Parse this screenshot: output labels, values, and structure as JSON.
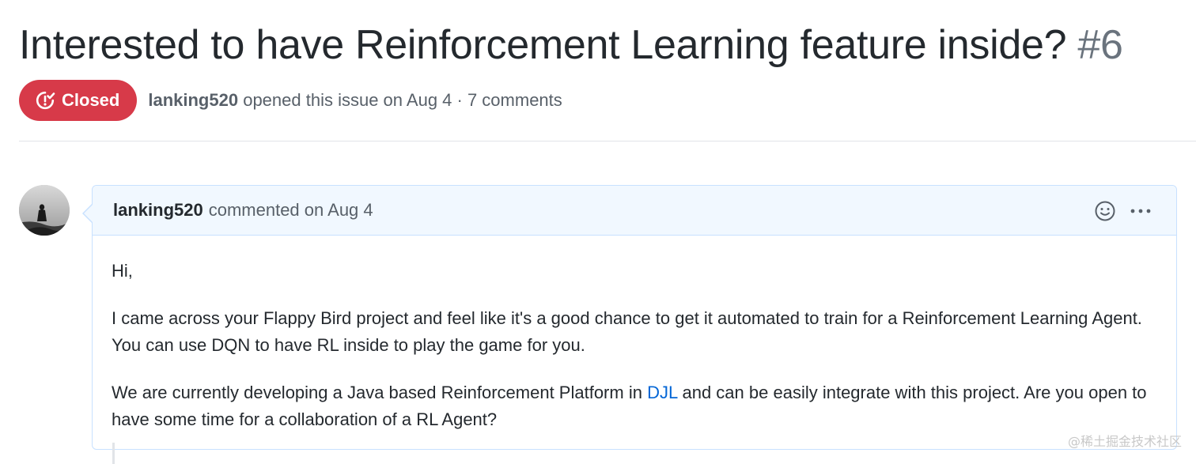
{
  "issue": {
    "title": "Interested to have Reinforcement Learning feature inside?",
    "number": "#6",
    "state": "Closed",
    "author": "lanking520",
    "meta_text": "opened this issue on Aug 4 · 7 comments"
  },
  "comment": {
    "author": "lanking520",
    "action": "commented on Aug 4",
    "body": {
      "p1": "Hi,",
      "p2": "I came across your Flappy Bird project and feel like it's a good chance to get it automated to train for a Reinforcement Learning Agent. You can use DQN to have RL inside to play the game for you.",
      "p3_before": "We are currently developing a Java based Reinforcement Platform in ",
      "p3_link": "DJL",
      "p3_after": " and can be easily integrate with this project. Are you open to have some time for a collaboration of a RL Agent?"
    }
  },
  "icons": {
    "state": "issue-closed-icon",
    "reaction": "smiley-icon",
    "more": "kebab-horizontal-icon"
  },
  "watermark": "@稀土掘金技术社区",
  "colors": {
    "closed_badge": "#d73a49",
    "link": "#0366d6",
    "comment_header_bg": "#f1f8ff",
    "comment_border": "#c8e1ff"
  }
}
